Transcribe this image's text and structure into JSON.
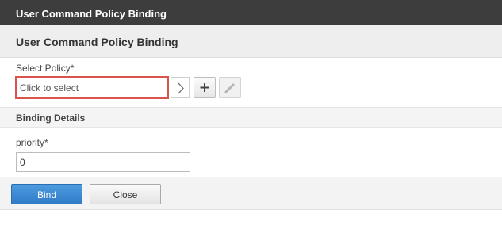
{
  "window": {
    "title": "User Command Policy Binding"
  },
  "section": {
    "title": "User Command Policy Binding"
  },
  "policy": {
    "label": "Select Policy*",
    "placeholder": "Click to select",
    "invalid_border_color": "#d9534f",
    "buttons": [
      {
        "icon": "chevron-right-icon"
      },
      {
        "icon": "plus-icon"
      },
      {
        "icon": "pencil-icon",
        "enabled": false
      }
    ]
  },
  "binding_details": {
    "title": "Binding Details",
    "priority_label": "priority*",
    "priority_value": "0"
  },
  "footer": {
    "bind_label": "Bind",
    "close_label": "Close",
    "primary_color": "#3a86d2"
  }
}
